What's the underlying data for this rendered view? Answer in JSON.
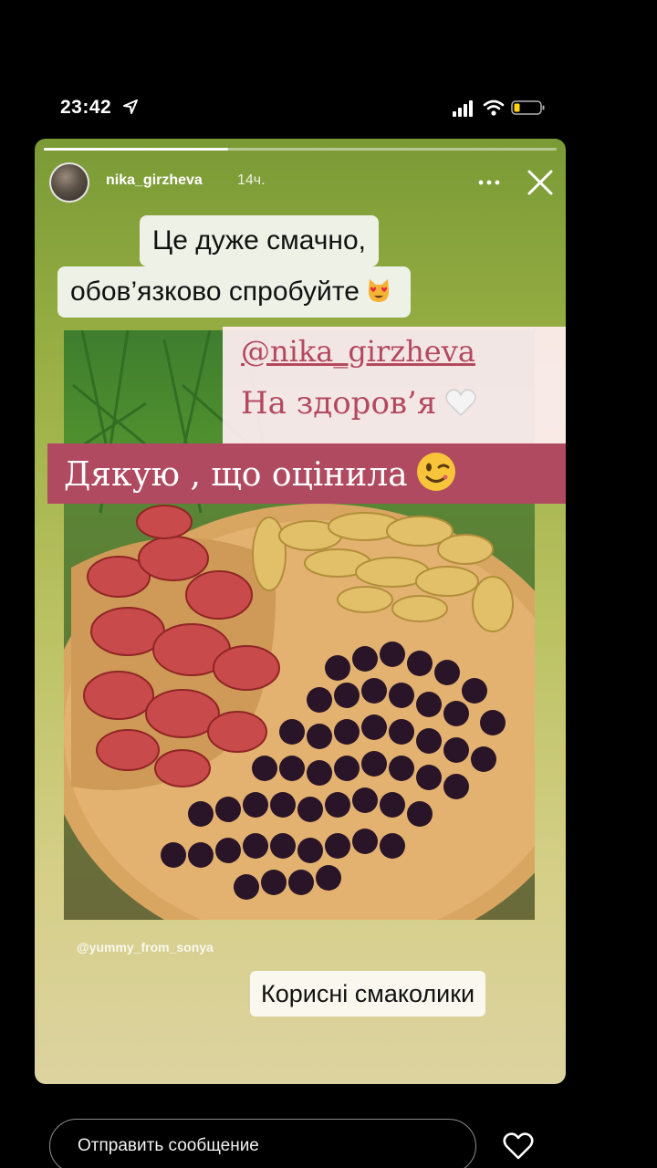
{
  "status": {
    "time": "23:42"
  },
  "story": {
    "username": "nika_girzheva",
    "time_ago": "14ч.",
    "progress": 0.36,
    "caption_line1": "Це дуже смачно,",
    "caption_line2": "обов’язково спробуйте",
    "mention": "@nika_girzheva",
    "mention_text": "На здоров’я",
    "thanks_text": "Дякую , що оцінила",
    "watermark": "@yummy_from_sonya",
    "tag": "Корисні смаколики",
    "emoji": {
      "cat": "heart-eyes-cat-emoji",
      "heart": "white-heart-emoji",
      "wink": "winking-face-emoji"
    }
  },
  "reply": {
    "placeholder": "Отправить сообщение"
  },
  "colors": {
    "accent_pink": "#b04a60",
    "mention_pink": "#b4485e",
    "card_top": "#7a9a36",
    "card_bottom": "#dcd3a0"
  }
}
